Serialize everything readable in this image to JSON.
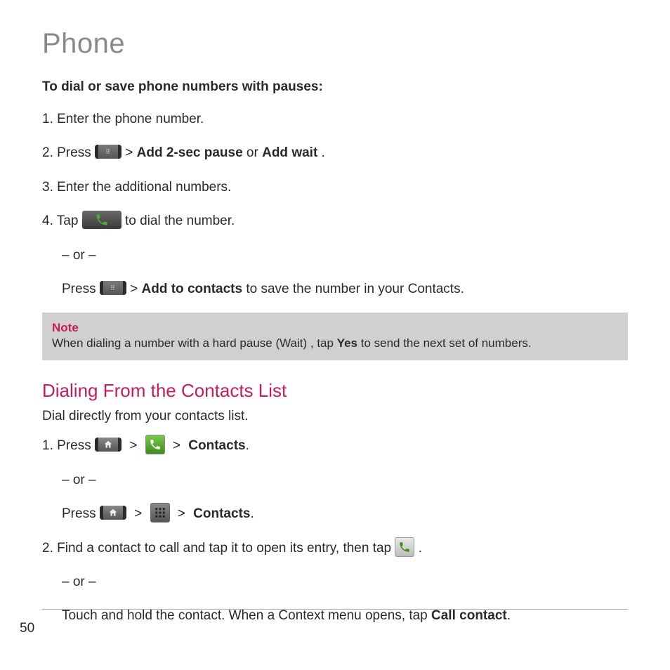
{
  "page_title": "Phone",
  "page_number": "50",
  "section1": {
    "subtitle": "To dial or save phone numbers with pauses:",
    "step1": "1. Enter the phone number.",
    "step2_prefix": "2. Press ",
    "step2_gt": " > ",
    "step2_bold1": "Add 2-sec pause",
    "step2_mid": " or ",
    "step2_bold2": "Add wait",
    "step2_suffix": ".",
    "step3": "3. Enter the additional numbers.",
    "step4_prefix": "4. Tap ",
    "step4_suffix": " to dial the number.",
    "or": "– or –",
    "press_prefix": "Press ",
    "press_gt": " > ",
    "press_bold": "Add to contacts",
    "press_suffix": " to save the number in your Contacts."
  },
  "note": {
    "label": "Note",
    "text_prefix": "When dialing a number with a hard pause (Wait) , tap ",
    "text_bold": "Yes",
    "text_suffix": " to send the next set of numbers."
  },
  "section2": {
    "heading": "Dialing From the Contacts List",
    "intro": "Dial directly from your contacts list.",
    "step1_prefix": "1. Press ",
    "gt": " > ",
    "contacts": "Contacts",
    "period": ".",
    "or": "– or –",
    "press_prefix": "Press ",
    "step2_prefix": "2. Find a contact to call and tap it to open its entry, then tap ",
    "step2_suffix": ".",
    "touch_hold_prefix": "Touch and hold the contact. When a Context menu opens, tap ",
    "call_contact": "Call contact"
  }
}
